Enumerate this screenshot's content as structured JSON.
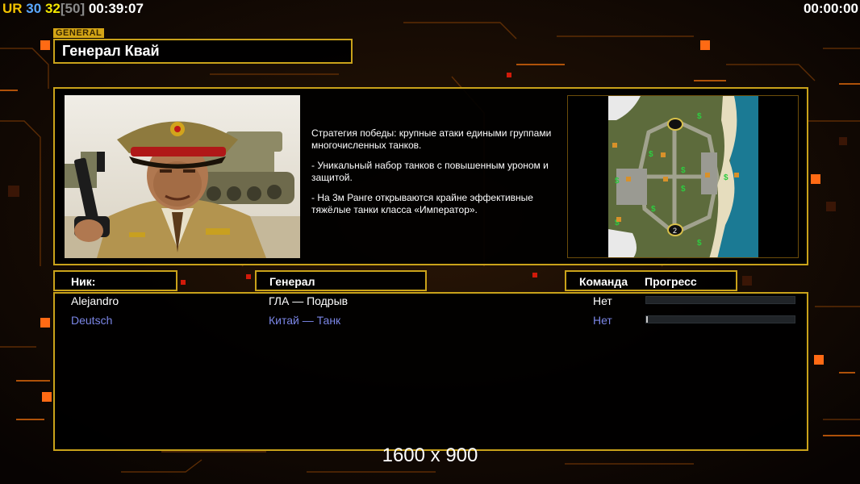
{
  "topbar": {
    "ur": "UR",
    "stat_a": "30",
    "stat_b": "32",
    "stat_c": "[50]",
    "elapsed": "00:39:07",
    "countdown": "00:00:00"
  },
  "general": {
    "tag": "GENERAL",
    "name": "Генерал Квай",
    "description": [
      "Стратегия победы: крупные атаки едиными группами многочисленных танков.",
      "- Уникальный набор танков с повышенным уроном и защитой.",
      "- На 3м Ранге открываются крайне эффективные тяжёлые танки класса «Император»."
    ]
  },
  "minimap": {
    "start_marker": "2"
  },
  "table": {
    "headers": {
      "nick": "Ник:",
      "general": "Генерал",
      "team": "Команда",
      "progress": "Прогресс"
    },
    "players": [
      {
        "nick": "Alejandro",
        "general": "ГЛА — Подрыв",
        "team": "Нет",
        "progress": 0.0,
        "color": "#ffffff"
      },
      {
        "nick": "Deutsch",
        "general": "Китай — Танк",
        "team": "Нет",
        "progress": 0.01,
        "color": "#7b86e6"
      }
    ]
  },
  "resolution": "1600 x 900",
  "colors": {
    "frame_gold": "#c9a21a",
    "accent_orange": "#ff7a1a"
  }
}
